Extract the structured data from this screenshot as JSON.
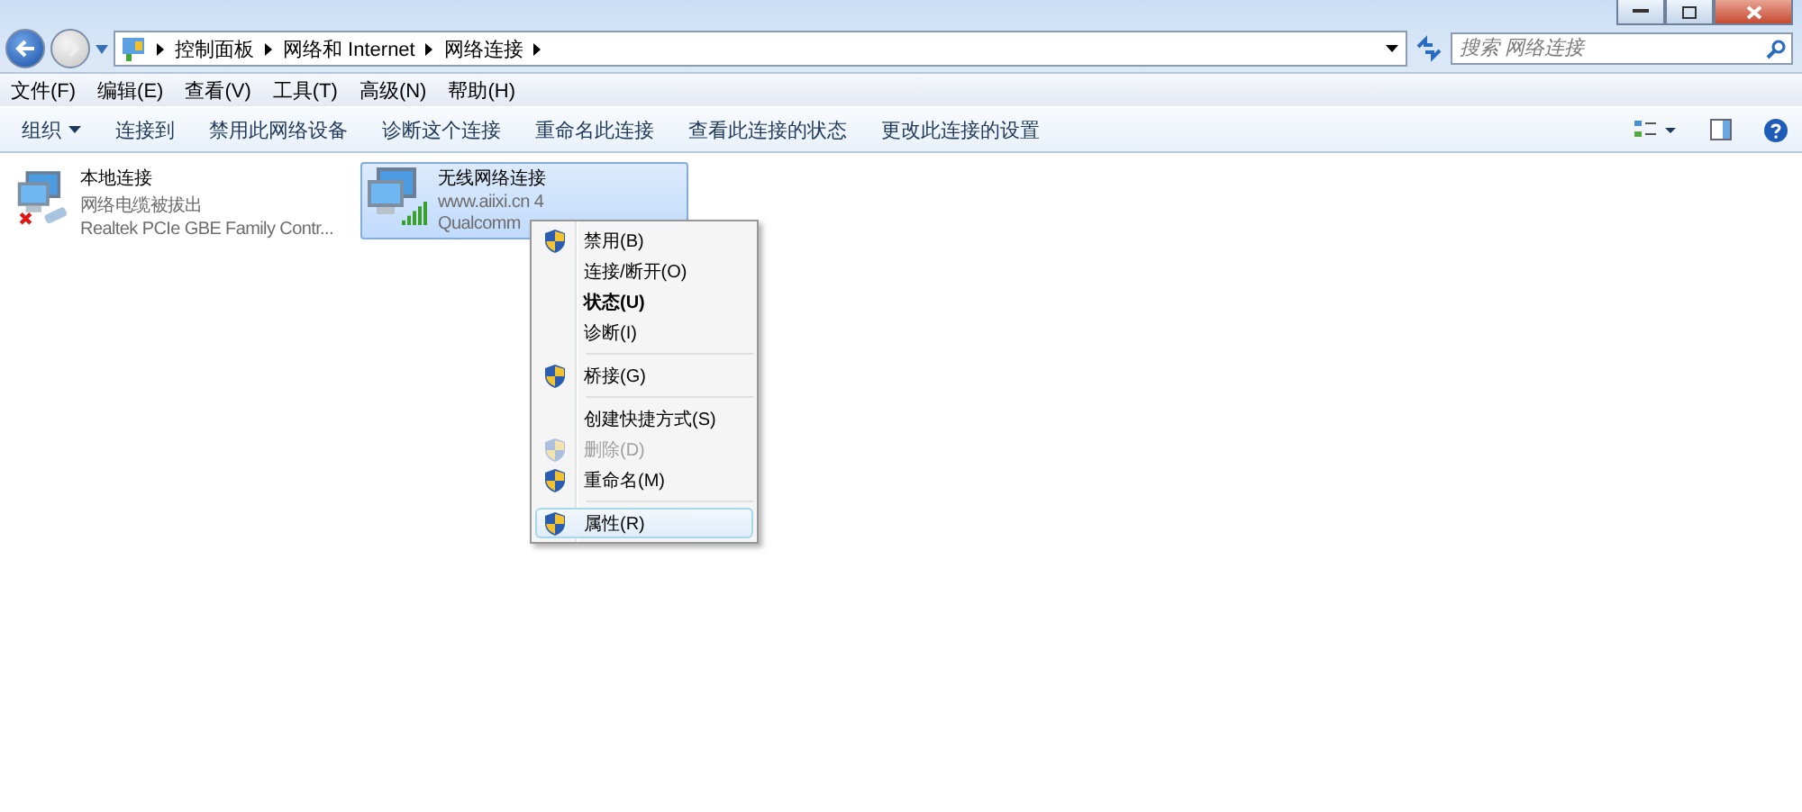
{
  "breadcrumb": [
    "控制面板",
    "网络和 Internet",
    "网络连接"
  ],
  "search": {
    "placeholder": "搜索 网络连接"
  },
  "menu_bar": [
    "文件(F)",
    "编辑(E)",
    "查看(V)",
    "工具(T)",
    "高级(N)",
    "帮助(H)"
  ],
  "toolbar": [
    {
      "label": "组织",
      "dropdown": true
    },
    {
      "label": "连接到",
      "dropdown": false
    },
    {
      "label": "禁用此网络设备",
      "dropdown": false
    },
    {
      "label": "诊断这个连接",
      "dropdown": false
    },
    {
      "label": "重命名此连接",
      "dropdown": false
    },
    {
      "label": "查看此连接的状态",
      "dropdown": false
    },
    {
      "label": "更改此连接的设置",
      "dropdown": false
    }
  ],
  "connections": [
    {
      "name": "本地连接",
      "status": "网络电缆被拔出",
      "device": "Realtek PCIe GBE Family Contr...",
      "kind": "wired",
      "selected": false
    },
    {
      "name": "无线网络连接",
      "status": "www.aiixi.cn  4",
      "device": "Qualcomm",
      "kind": "wireless",
      "selected": true
    }
  ],
  "context_menu": [
    {
      "kind": "item",
      "label": "禁用(B)",
      "shield": true,
      "bold": false,
      "disabled": false,
      "selected": false
    },
    {
      "kind": "item",
      "label": "连接/断开(O)",
      "shield": false,
      "bold": false,
      "disabled": false,
      "selected": false
    },
    {
      "kind": "item",
      "label": "状态(U)",
      "shield": false,
      "bold": true,
      "disabled": false,
      "selected": false
    },
    {
      "kind": "item",
      "label": "诊断(I)",
      "shield": false,
      "bold": false,
      "disabled": false,
      "selected": false
    },
    {
      "kind": "separator"
    },
    {
      "kind": "item",
      "label": "桥接(G)",
      "shield": true,
      "bold": false,
      "disabled": false,
      "selected": false
    },
    {
      "kind": "separator"
    },
    {
      "kind": "item",
      "label": "创建快捷方式(S)",
      "shield": false,
      "bold": false,
      "disabled": false,
      "selected": false
    },
    {
      "kind": "item",
      "label": "删除(D)",
      "shield": true,
      "bold": false,
      "disabled": true,
      "selected": false
    },
    {
      "kind": "item",
      "label": "重命名(M)",
      "shield": true,
      "bold": false,
      "disabled": false,
      "selected": false
    },
    {
      "kind": "separator"
    },
    {
      "kind": "item",
      "label": "属性(R)",
      "shield": true,
      "bold": false,
      "disabled": false,
      "selected": true
    }
  ]
}
